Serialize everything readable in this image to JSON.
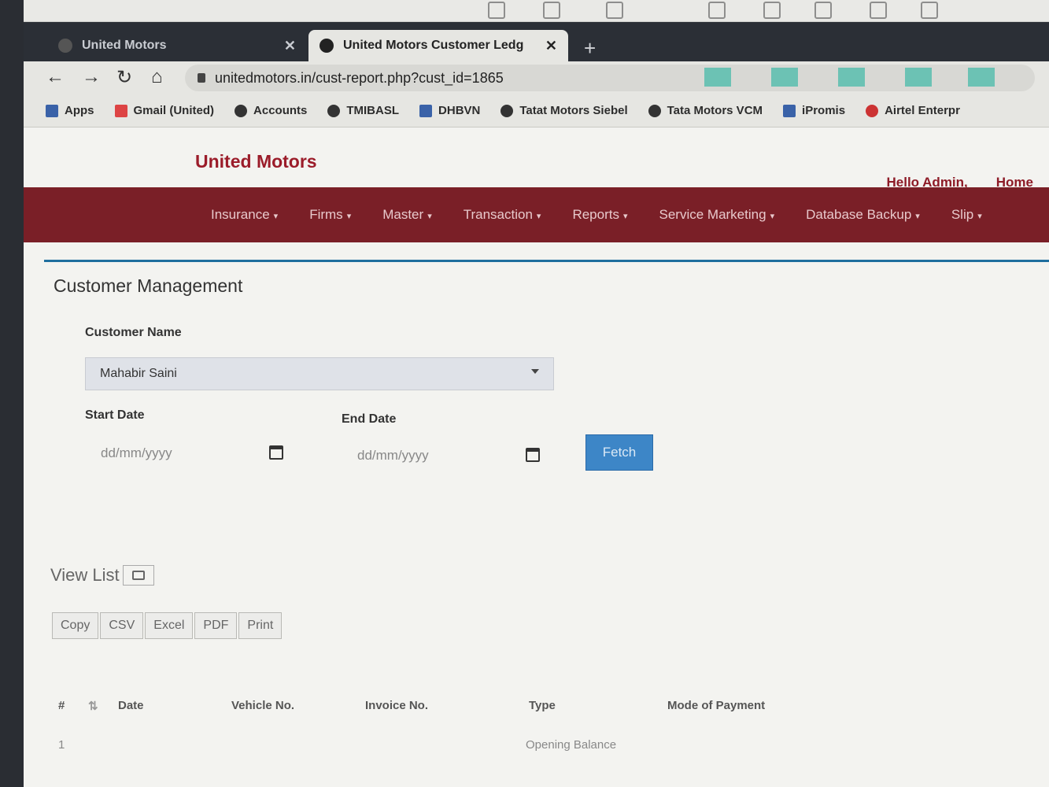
{
  "browser": {
    "tabs": [
      {
        "label": "United Motors"
      },
      {
        "label": "United Motors Customer Ledg"
      }
    ],
    "url": "unitedmotors.in/cust-report.php?cust_id=1865",
    "bookmarks": [
      {
        "label": "Apps",
        "icon": "grid-icon"
      },
      {
        "label": "Gmail (United)",
        "icon": "gmail-icon"
      },
      {
        "label": "Accounts",
        "icon": "globe-icon"
      },
      {
        "label": "TMIBASL",
        "icon": "globe-icon"
      },
      {
        "label": "DHBVN",
        "icon": "site-icon"
      },
      {
        "label": "Tatat Motors Siebel",
        "icon": "globe-icon"
      },
      {
        "label": "Tata Motors VCM",
        "icon": "globe-icon"
      },
      {
        "label": "iPromis",
        "icon": "user-icon"
      },
      {
        "label": "Airtel Enterpr",
        "icon": "airtel-icon"
      }
    ]
  },
  "header": {
    "brand": "United Motors",
    "hello": "Hello Admin,",
    "home": "Home"
  },
  "menu": [
    {
      "label": "Insurance"
    },
    {
      "label": "Firms"
    },
    {
      "label": "Master"
    },
    {
      "label": "Transaction"
    },
    {
      "label": "Reports"
    },
    {
      "label": "Service Marketing"
    },
    {
      "label": "Database Backup"
    },
    {
      "label": "Slip"
    }
  ],
  "form": {
    "title": "Customer Management",
    "customer_label": "Customer Name",
    "customer_value": "Mahabir Saini",
    "start_label": "Start Date",
    "start_placeholder": "dd/mm/yyyy",
    "end_label": "End Date",
    "end_placeholder": "dd/mm/yyyy",
    "fetch_label": "Fetch"
  },
  "list": {
    "title": "View List",
    "export_buttons": [
      "Copy",
      "CSV",
      "Excel",
      "PDF",
      "Print"
    ],
    "columns": [
      "#",
      "Date",
      "Vehicle No.",
      "Invoice No.",
      "Type",
      "Mode of Payment"
    ],
    "rows": [
      {
        "num": "1",
        "type": "Opening Balance"
      }
    ]
  }
}
